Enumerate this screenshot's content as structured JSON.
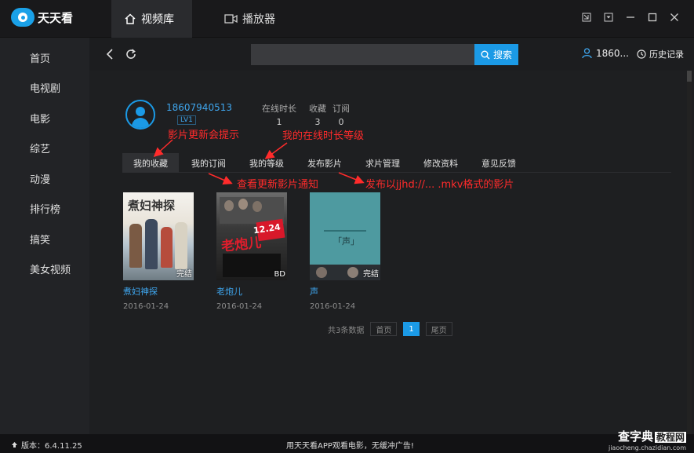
{
  "app": {
    "name": "天天看"
  },
  "top_tabs": [
    {
      "label": "视频库",
      "icon": "home-icon",
      "active": true
    },
    {
      "label": "播放器",
      "icon": "video-camera-icon",
      "active": false
    }
  ],
  "window_controls": [
    "restore-mini-icon",
    "menu-dropdown-icon",
    "minimize-icon",
    "maximize-icon",
    "close-icon"
  ],
  "sidebar": {
    "items": [
      {
        "label": "首页"
      },
      {
        "label": "电视剧"
      },
      {
        "label": "电影"
      },
      {
        "label": "综艺"
      },
      {
        "label": "动漫"
      },
      {
        "label": "排行榜"
      },
      {
        "label": "搞笑"
      },
      {
        "label": "美女视频"
      }
    ]
  },
  "search": {
    "value": "",
    "placeholder": "",
    "button_label": "搜索"
  },
  "header_right": {
    "user_label": "1860...",
    "history_label": "历史记录"
  },
  "profile": {
    "username": "18607940513",
    "level": "LV1",
    "stats": [
      {
        "label": "在线时长",
        "value": "1"
      },
      {
        "label": "收藏",
        "value": "3"
      },
      {
        "label": "订阅",
        "value": "0"
      }
    ]
  },
  "tabs": [
    {
      "label": "我的收藏",
      "active": true
    },
    {
      "label": "我的订阅",
      "active": false
    },
    {
      "label": "我的等级",
      "active": false
    },
    {
      "label": "发布影片",
      "active": false
    },
    {
      "label": "求片管理",
      "active": false
    },
    {
      "label": "修改资料",
      "active": false
    },
    {
      "label": "意见反馈",
      "active": false
    }
  ],
  "annotations": {
    "update_hint": "影片更新会提示",
    "level_hint": "我的在线时长等级",
    "subscribe_hint": "查看更新影片通知",
    "publish_hint": "发布以jjhd://... .mkv格式的影片"
  },
  "movies": [
    {
      "title": "煮妇神探",
      "date": "2016-01-24",
      "badge": "完结",
      "poster_text": "煮妇神探"
    },
    {
      "title": "老炮儿",
      "date": "2016-01-24",
      "badge": "BD",
      "poster_text": "老炮儿",
      "poster_date": "12.24"
    },
    {
      "title": "声",
      "date": "2016-01-24",
      "badge": "完结",
      "poster_text": "「声」"
    }
  ],
  "pagination": {
    "summary": "共3条数据",
    "first": "首页",
    "current": "1",
    "last": "尾页"
  },
  "status": {
    "version": "版本：6.4.11.25",
    "ad": "用天天看APP观看电影，无缓冲广告!",
    "watermark_main": "查字典",
    "watermark_tag": "教程网",
    "watermark_url": "jiaocheng.chazidian.com"
  },
  "colors": {
    "accent": "#1b9ae6",
    "annotation": "#ff2b2b",
    "background": "#1e1f21"
  }
}
